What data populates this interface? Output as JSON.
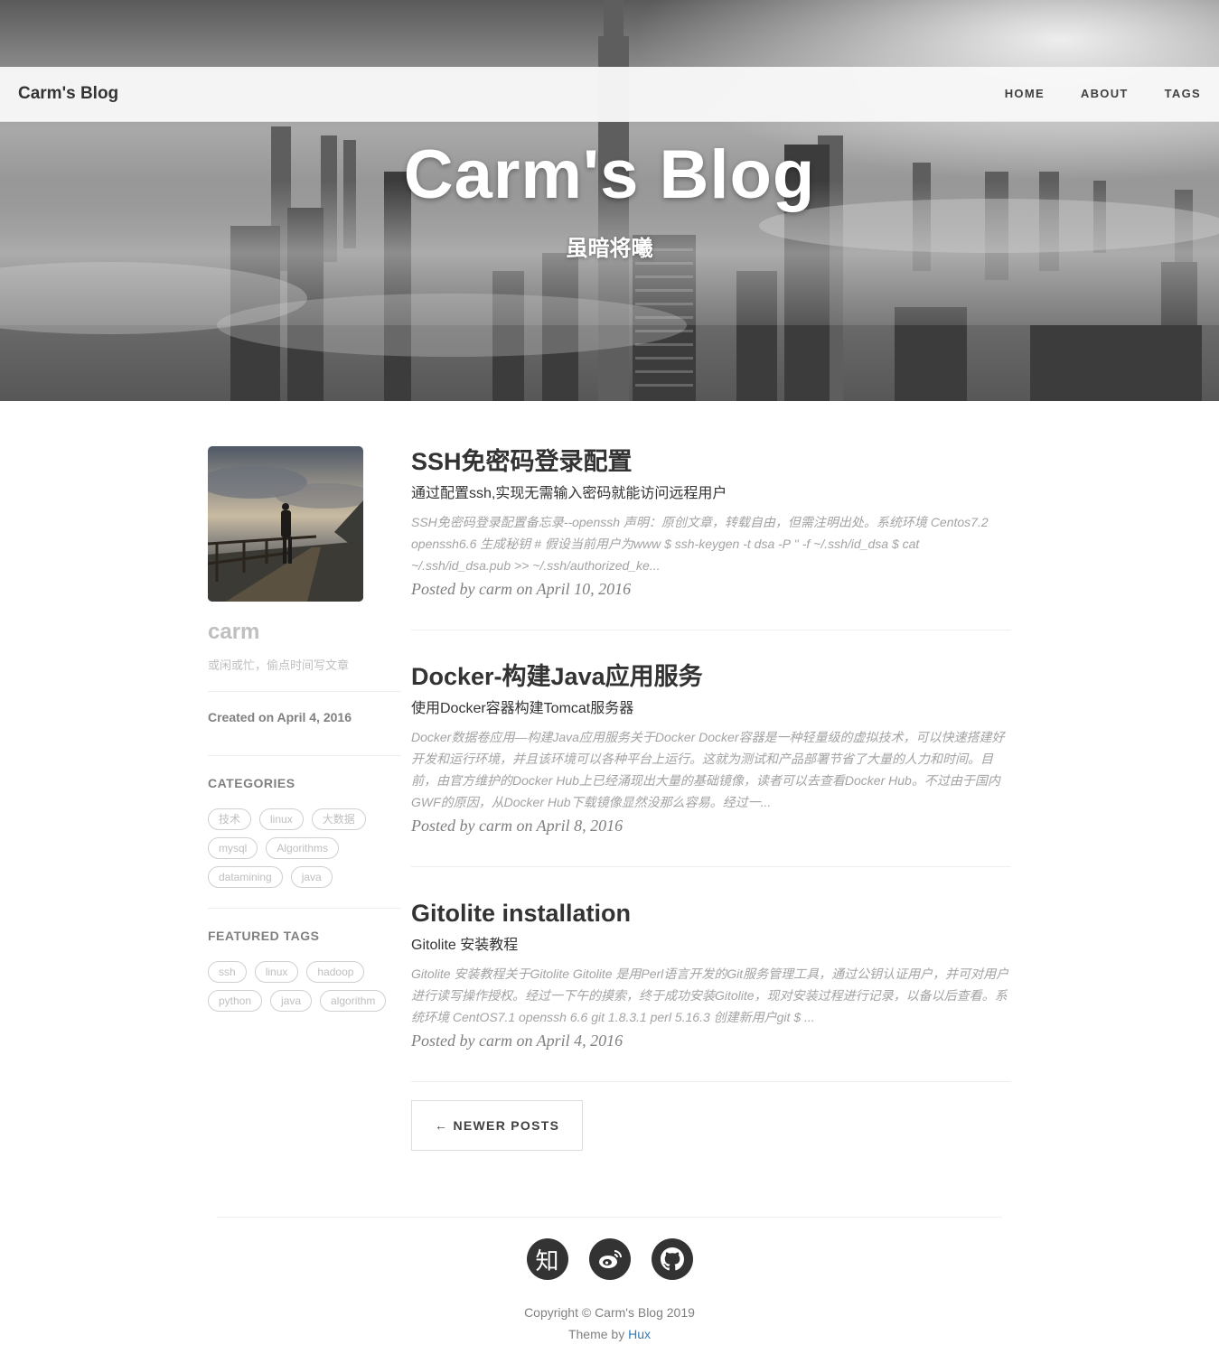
{
  "nav": {
    "brand": "Carm's Blog",
    "links": [
      "HOME",
      "ABOUT",
      "TAGS"
    ]
  },
  "hero": {
    "title": "Carm's Blog",
    "subtitle": "虽暗将曦"
  },
  "sidebar": {
    "author": "carm",
    "bio": "或闲或忙，偷点时间写文章",
    "created": "Created on April 4, 2016",
    "categories_title": "CATEGORIES",
    "categories": [
      "技术",
      "linux",
      "大数据",
      "mysql",
      "Algorithms",
      "datamining",
      "java"
    ],
    "featured_title": "FEATURED TAGS",
    "featured_tags": [
      "ssh",
      "linux",
      "hadoop",
      "python",
      "java",
      "algorithm"
    ]
  },
  "posts": [
    {
      "title": "SSH免密码登录配置",
      "subtitle": "通过配置ssh,实现无需输入密码就能访问远程用户",
      "excerpt": "SSH免密码登录配置备忘录--openssh 声明：原创文章，转载自由，但需注明出处。系统环境 Centos7.2 openssh6.6 生成秘钥 # 假设当前用户为www $ ssh-keygen -t dsa -P '' -f ~/.ssh/id_dsa $ cat ~/.ssh/id_dsa.pub >> ~/.ssh/authorized_ke...",
      "meta": "Posted by carm on April 10, 2016"
    },
    {
      "title": "Docker-构建Java应用服务",
      "subtitle": "使用Docker容器构建Tomcat服务器",
      "excerpt": "Docker数据卷应用—构建Java应用服务关于Docker Docker容器是一种轻量级的虚拟技术，可以快速搭建好开发和运行环境，并且该环境可以各种平台上运行。这就为测试和产品部署节省了大量的人力和时间。目前，由官方维护的Docker Hub上已经涌现出大量的基础镜像，读者可以去查看Docker Hub。不过由于国内GWF的原因，从Docker Hub下载镜像显然没那么容易。经过一...",
      "meta": "Posted by carm on April 8, 2016"
    },
    {
      "title": "Gitolite installation",
      "subtitle": "Gitolite 安装教程",
      "excerpt": "Gitolite 安装教程关于Gitolite Gitolite 是用Perl语言开发的Git服务管理工具，通过公钥认证用户，并可对用户进行读写操作授权。经过一下午的摸索，终于成功安装Gitolite，现对安装过程进行记录，以备以后查看。系统环境 CentOS7.1 openssh 6.6 git 1.8.3.1 perl 5.16.3 创建新用户git $ ...",
      "meta": "Posted by carm on April 4, 2016"
    }
  ],
  "pager": {
    "newer": "← NEWER POSTS"
  },
  "footer": {
    "social": [
      "zhihu-icon",
      "weibo-icon",
      "github-icon"
    ],
    "zhihu_glyph": "知",
    "copyright": "Copyright © Carm's Blog 2019",
    "theme_prefix": "Theme by ",
    "theme_link": "Hux"
  }
}
